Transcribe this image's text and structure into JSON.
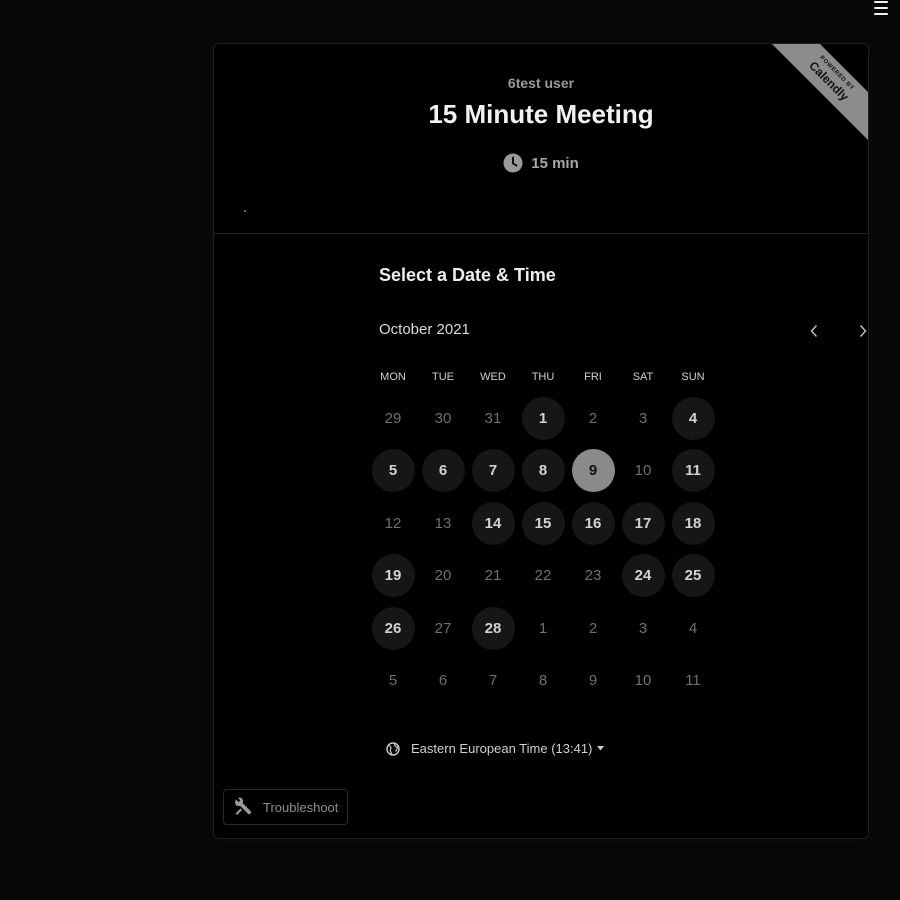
{
  "menu": {
    "icon": "hamburger-icon"
  },
  "header": {
    "org_name": "6test user",
    "event_title": "15 Minute Meeting",
    "duration": "15 min",
    "duration_icon": "clock-icon"
  },
  "badge": {
    "small": "POWERED BY",
    "big": "Calendly"
  },
  "calendar": {
    "section_title": "Select a Date & Time",
    "month": "October 2021",
    "prev_icon": "chevron-left-icon",
    "next_icon": "chevron-right-icon",
    "weekdays": [
      "MON",
      "TUE",
      "WED",
      "THU",
      "FRI",
      "SAT",
      "SUN"
    ],
    "days": [
      {
        "label": "29",
        "state": "unavailable"
      },
      {
        "label": "30",
        "state": "unavailable"
      },
      {
        "label": "31",
        "state": "unavailable"
      },
      {
        "label": "1",
        "state": "available"
      },
      {
        "label": "2",
        "state": "unavailable"
      },
      {
        "label": "3",
        "state": "unavailable"
      },
      {
        "label": "4",
        "state": "available"
      },
      {
        "label": "5",
        "state": "available"
      },
      {
        "label": "6",
        "state": "available"
      },
      {
        "label": "7",
        "state": "available"
      },
      {
        "label": "8",
        "state": "available"
      },
      {
        "label": "9",
        "state": "selected"
      },
      {
        "label": "10",
        "state": "unavailable"
      },
      {
        "label": "11",
        "state": "available"
      },
      {
        "label": "12",
        "state": "unavailable"
      },
      {
        "label": "13",
        "state": "unavailable"
      },
      {
        "label": "14",
        "state": "available"
      },
      {
        "label": "15",
        "state": "available"
      },
      {
        "label": "16",
        "state": "available"
      },
      {
        "label": "17",
        "state": "available"
      },
      {
        "label": "18",
        "state": "available"
      },
      {
        "label": "19",
        "state": "available"
      },
      {
        "label": "20",
        "state": "unavailable"
      },
      {
        "label": "21",
        "state": "unavailable"
      },
      {
        "label": "22",
        "state": "unavailable"
      },
      {
        "label": "23",
        "state": "unavailable"
      },
      {
        "label": "24",
        "state": "available"
      },
      {
        "label": "25",
        "state": "available"
      },
      {
        "label": "26",
        "state": "available"
      },
      {
        "label": "27",
        "state": "unavailable"
      },
      {
        "label": "28",
        "state": "available"
      },
      {
        "label": "1",
        "state": "unavailable"
      },
      {
        "label": "2",
        "state": "unavailable"
      },
      {
        "label": "3",
        "state": "unavailable"
      },
      {
        "label": "4",
        "state": "unavailable"
      },
      {
        "label": "5",
        "state": "unavailable"
      },
      {
        "label": "6",
        "state": "unavailable"
      },
      {
        "label": "7",
        "state": "unavailable"
      },
      {
        "label": "8",
        "state": "unavailable"
      },
      {
        "label": "9",
        "state": "unavailable"
      },
      {
        "label": "10",
        "state": "unavailable"
      },
      {
        "label": "11",
        "state": "unavailable"
      }
    ]
  },
  "timezone": {
    "label": "Eastern European Time (13:41)",
    "icon": "globe-icon"
  },
  "troubleshoot": {
    "label": "Troubleshoot",
    "icon": "wrench-icon"
  },
  "colors": {
    "background": "#000000",
    "available_day_bg": "#161616",
    "selected_day_bg": "#8a8a8a",
    "badge_bg": "#8c8c8c"
  }
}
